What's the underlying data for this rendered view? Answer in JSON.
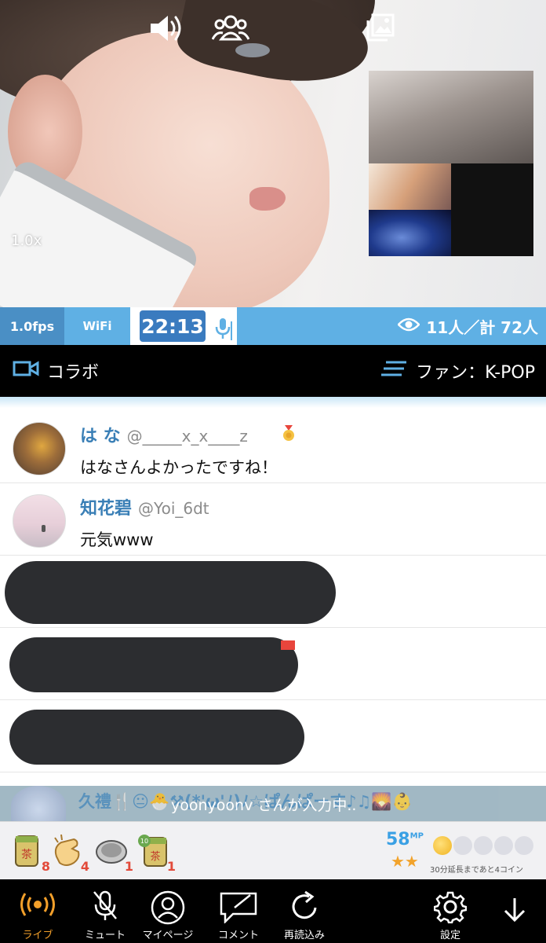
{
  "video": {
    "zoom": "1.0x"
  },
  "status": {
    "fps": "1.0fps",
    "network": "WiFi",
    "time": "22:13",
    "viewers": "11人／計 72人"
  },
  "collab_bar": {
    "collab_label": "コラボ",
    "fan_label": "ファン：K-POP"
  },
  "comments": [
    {
      "name": "は な",
      "handle": "@_____x_x____z",
      "text": "はなさんよかったですね！"
    },
    {
      "name": "知花碧",
      "handle": "@Yoi_6dt",
      "text": "元気www"
    }
  ],
  "typing": {
    "name": "久禮🍴😐🐣⚒(*'ω'ﾉ)ﾉ☆ぱんぱーす♪♫🌄👶",
    "text": "yoonyoonv さんが入力中.."
  },
  "gifts": [
    {
      "icon": "tea-icon",
      "count": "8"
    },
    {
      "icon": "clap-icon",
      "count": "4"
    },
    {
      "icon": "disc-icon",
      "count": "1"
    },
    {
      "icon": "tea10-icon",
      "count": "1"
    }
  ],
  "mp": {
    "value": "58",
    "unit": "MP",
    "stars": "★★"
  },
  "coins": {
    "filled": 1,
    "total": 5,
    "note": "30分延長まであと4コイン"
  },
  "nav": {
    "live": "ライブ",
    "mute": "ミュート",
    "mypage": "マイページ",
    "comment": "コメント",
    "reload": "再読込み",
    "settings": "設定"
  },
  "colors": {
    "accent_blue": "#5fb0e4",
    "timer_blue": "#3a7bbf",
    "active_orange": "#f29f2a",
    "name_blue": "#3a7fb6"
  }
}
